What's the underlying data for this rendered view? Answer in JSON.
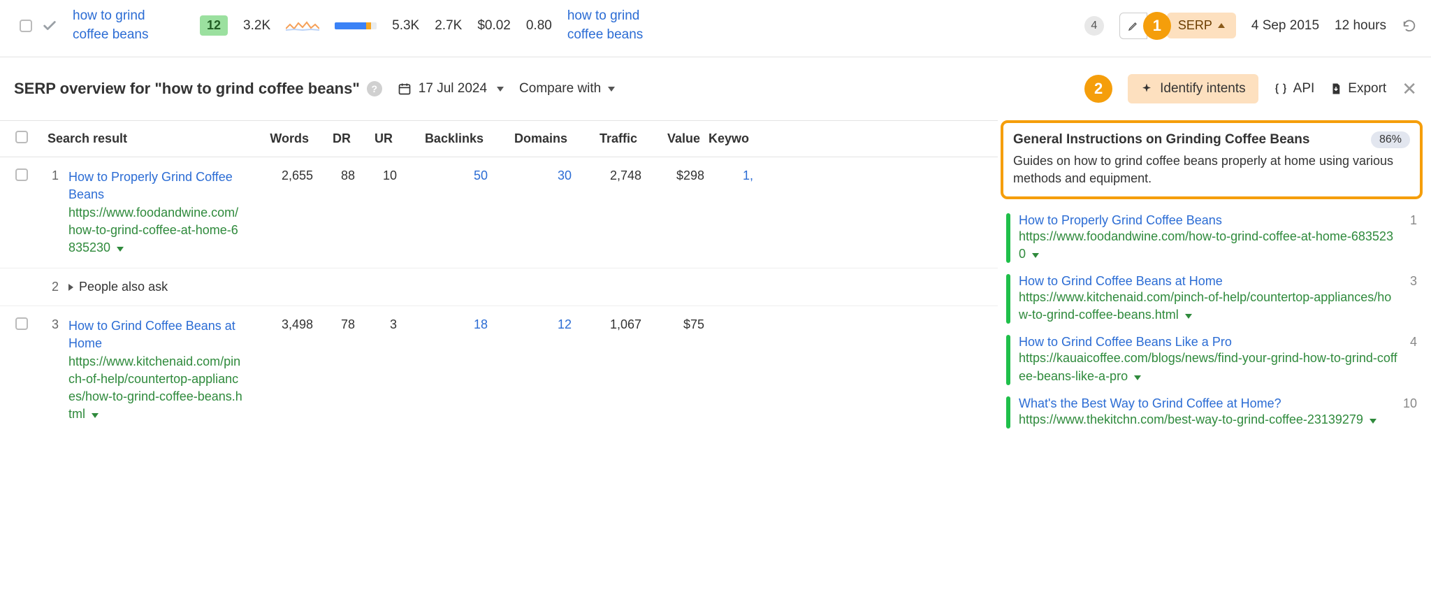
{
  "keyword_row": {
    "keyword": "how to grind coffee beans",
    "kd_badge": "12",
    "volume": "3.2K",
    "gv": "5.3K",
    "tp": "2.7K",
    "cpc": "$0.02",
    "ctr": "0.80",
    "parent_topic": "how to grind coffee beans",
    "sf_count": "4",
    "serp_button": "SERP",
    "updated": "4 Sep 2015",
    "refresh_in": "12 hours"
  },
  "annotations": {
    "a1": "1",
    "a2": "2"
  },
  "overview": {
    "title_prefix": "SERP overview for ",
    "title_quoted": "\"how to grind coffee beans\"",
    "date": "17 Jul 2024",
    "compare": "Compare with",
    "identify": "Identify intents",
    "api": "API",
    "export": "Export"
  },
  "table": {
    "headers": {
      "search_result": "Search result",
      "words": "Words",
      "dr": "DR",
      "ur": "UR",
      "backlinks": "Backlinks",
      "domains": "Domains",
      "traffic": "Traffic",
      "value": "Value",
      "keywords": "Keywo"
    },
    "rows": [
      {
        "rank": "1",
        "title": "How to Properly Grind Coffee Beans",
        "url": "https://www.foodandwine.com/how-to-grind-coffee-at-home-6835230",
        "words": "2,655",
        "dr": "88",
        "ur": "10",
        "backlinks": "50",
        "domains": "30",
        "traffic": "2,748",
        "value": "$298",
        "keywords": "1,"
      },
      {
        "rank": "2",
        "paa": "People also ask"
      },
      {
        "rank": "3",
        "title": "How to Grind Coffee Beans at Home",
        "url": "https://www.kitchenaid.com/pinch-of-help/countertop-appliances/how-to-grind-coffee-beans.html",
        "words": "3,498",
        "dr": "78",
        "ur": "3",
        "backlinks": "18",
        "domains": "12",
        "traffic": "1,067",
        "value": "$75",
        "keywords": ""
      }
    ]
  },
  "intent": {
    "title": "General Instructions on Grinding Coffee Beans",
    "pct": "86%",
    "desc": "Guides on how to grind coffee beans properly at home using various methods and equipment.",
    "items": [
      {
        "title": "How to Properly Grind Coffee Beans",
        "url": "https://www.foodandwine.com/how-to-grind-coffee-at-home-6835230",
        "rank": "1"
      },
      {
        "title": "How to Grind Coffee Beans at Home",
        "url": "https://www.kitchenaid.com/pinch-of-help/countertop-appliances/how-to-grind-coffee-beans.html",
        "rank": "3"
      },
      {
        "title": "How to Grind Coffee Beans Like a Pro",
        "url": "https://kauaicoffee.com/blogs/news/find-your-grind-how-to-grind-coffee-beans-like-a-pro",
        "rank": "4"
      },
      {
        "title": "What's the Best Way to Grind Coffee at Home?",
        "url": "https://www.thekitchn.com/best-way-to-grind-coffee-23139279",
        "rank": "10"
      }
    ]
  }
}
